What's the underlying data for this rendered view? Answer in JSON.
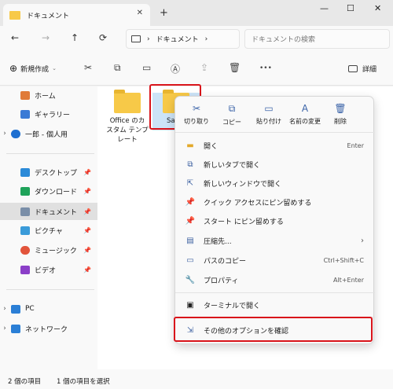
{
  "tab": {
    "title": "ドキュメント",
    "close": "✕",
    "new": "+"
  },
  "window": {
    "minimize": "—",
    "maximize": "☐",
    "close": "✕"
  },
  "nav": {
    "back": "←",
    "forward": "→",
    "up": "↑",
    "refresh": "⟳"
  },
  "address": {
    "separator": "›",
    "folder": "ドキュメント",
    "trail": "›"
  },
  "search": {
    "placeholder": "ドキュメントの検索"
  },
  "toolbar": {
    "new_label": "新規作成",
    "more": "•••",
    "details": "詳細"
  },
  "sidebar": {
    "items": [
      {
        "label": "ホーム",
        "chev": ""
      },
      {
        "label": "ギャラリー",
        "chev": ""
      },
      {
        "label": "一郎 - 個人用",
        "chev": "›"
      },
      {
        "label": "デスクトップ",
        "chev": ""
      },
      {
        "label": "ダウンロード",
        "chev": ""
      },
      {
        "label": "ドキュメント",
        "chev": ""
      },
      {
        "label": "ピクチャ",
        "chev": ""
      },
      {
        "label": "ミュージック",
        "chev": ""
      },
      {
        "label": "ビデオ",
        "chev": ""
      },
      {
        "label": "PC",
        "chev": "›"
      },
      {
        "label": "ネットワーク",
        "chev": "›"
      }
    ]
  },
  "files": [
    {
      "name1": "Office のカ",
      "name2": "スタム テンプ",
      "name3": "レート"
    },
    {
      "name1": "Sam"
    }
  ],
  "context_menu": {
    "top_actions": [
      {
        "label": "切り取り",
        "icon": "✂"
      },
      {
        "label": "コピー",
        "icon": "⧉"
      },
      {
        "label": "貼り付け",
        "icon": "📋"
      },
      {
        "label": "名前の変更",
        "icon": "A"
      },
      {
        "label": "削除",
        "icon": "🗑"
      }
    ],
    "items": [
      {
        "label": "開く",
        "shortcut": "Enter"
      },
      {
        "label": "新しいタブで開く",
        "shortcut": ""
      },
      {
        "label": "新しいウィンドウで開く",
        "shortcut": ""
      },
      {
        "label": "クイック アクセスにピン留めする",
        "shortcut": ""
      },
      {
        "label": "スタート にピン留めする",
        "shortcut": ""
      },
      {
        "label": "圧縮先...",
        "shortcut": "›"
      },
      {
        "label": "パスのコピー",
        "shortcut": "Ctrl+Shift+C"
      },
      {
        "label": "プロパティ",
        "shortcut": "Alt+Enter"
      },
      {
        "label": "ターミナルで開く",
        "shortcut": ""
      },
      {
        "label": "その他のオプションを確認",
        "shortcut": ""
      }
    ]
  },
  "status": {
    "count": "2 個の項目",
    "selected": "1 個の項目を選択"
  },
  "colors": {
    "accent": "#d9141b",
    "folder": "#f7c948"
  }
}
